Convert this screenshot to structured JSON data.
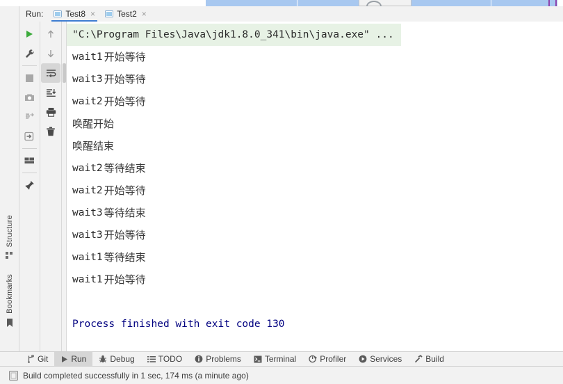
{
  "window": {
    "tool_window": "Run"
  },
  "tabbar": {
    "run_label": "Run:",
    "tabs": [
      {
        "label": "Test8",
        "close": "×",
        "active": true,
        "icon": "run-config-icon"
      },
      {
        "label": "Test2",
        "close": "×",
        "active": false,
        "icon": "run-config-icon"
      }
    ]
  },
  "toolbar_main": {
    "items": [
      {
        "name": "rerun-button",
        "icon": "play-icon",
        "tooltip": "Rerun"
      },
      {
        "name": "edit-configurations-button",
        "icon": "wrench-icon",
        "tooltip": "Modify Run Configuration"
      },
      {
        "name": "stop-button",
        "icon": "stop-square-icon",
        "tooltip": "Stop"
      },
      {
        "name": "screenshot-button",
        "icon": "camera-icon",
        "tooltip": "Screenshot"
      },
      {
        "name": "thread-dump-button",
        "icon": "thread-dump-icon",
        "tooltip": "Dump Threads"
      },
      {
        "name": "attach-button",
        "icon": "attach-arrow-icon",
        "tooltip": "Attach"
      },
      {
        "name": "layout-button",
        "icon": "layout-icon",
        "tooltip": "Layout Settings"
      },
      {
        "name": "pin-tab-button",
        "icon": "pin-icon",
        "tooltip": "Pin Tab"
      }
    ]
  },
  "toolbar_console": {
    "items": [
      {
        "name": "prev-occurrence-button",
        "icon": "arrow-up-icon",
        "tooltip": "Previous Occurrence"
      },
      {
        "name": "next-occurrence-button",
        "icon": "arrow-down-icon",
        "tooltip": "Next Occurrence"
      },
      {
        "name": "soft-wrap-button",
        "icon": "soft-wrap-icon",
        "tooltip": "Soft-Wrap",
        "active": true
      },
      {
        "name": "scroll-to-end-button",
        "icon": "scroll-to-end-icon",
        "tooltip": "Scroll to End"
      },
      {
        "name": "print-button",
        "icon": "printer-icon",
        "tooltip": "Print"
      },
      {
        "name": "clear-all-button",
        "icon": "trash-icon",
        "tooltip": "Clear All"
      }
    ]
  },
  "left_strip": {
    "items": [
      {
        "label": "Structure",
        "icon": "structure-icon"
      },
      {
        "label": "Bookmarks",
        "icon": "bookmark-icon"
      }
    ]
  },
  "console": {
    "lines": [
      {
        "type": "command",
        "text": "\"C:\\Program Files\\Java\\jdk1.8.0_341\\bin\\java.exe\" ..."
      },
      {
        "type": "log",
        "mono": "wait1",
        "cn": "开始等待"
      },
      {
        "type": "log",
        "mono": "wait3",
        "cn": "开始等待"
      },
      {
        "type": "log",
        "mono": "wait2",
        "cn": "开始等待"
      },
      {
        "type": "log",
        "mono": "",
        "cn": "唤醒开始"
      },
      {
        "type": "log",
        "mono": "",
        "cn": "唤醒结束"
      },
      {
        "type": "log",
        "mono": "wait2",
        "cn": "等待结束"
      },
      {
        "type": "log",
        "mono": "wait2",
        "cn": "开始等待"
      },
      {
        "type": "log",
        "mono": "wait3",
        "cn": "等待结束"
      },
      {
        "type": "log",
        "mono": "wait3",
        "cn": "开始等待"
      },
      {
        "type": "log",
        "mono": "wait1",
        "cn": "等待结束"
      },
      {
        "type": "log",
        "mono": "wait1",
        "cn": "开始等待"
      },
      {
        "type": "blank",
        "text": ""
      },
      {
        "type": "exit",
        "text": "Process finished with exit code 130"
      }
    ]
  },
  "bottom_bar": {
    "items": [
      {
        "label": "Git",
        "icon": "git-branch-icon",
        "active": false
      },
      {
        "label": "Run",
        "icon": "play-icon",
        "active": true
      },
      {
        "label": "Debug",
        "icon": "bug-icon",
        "active": false
      },
      {
        "label": "TODO",
        "icon": "list-icon",
        "active": false
      },
      {
        "label": "Problems",
        "icon": "info-circle-icon",
        "active": false
      },
      {
        "label": "Terminal",
        "icon": "terminal-icon",
        "active": false
      },
      {
        "label": "Profiler",
        "icon": "profiler-icon",
        "active": false
      },
      {
        "label": "Services",
        "icon": "services-icon",
        "active": false
      },
      {
        "label": "Build",
        "icon": "hammer-icon",
        "active": false
      }
    ]
  },
  "status_bar": {
    "icon": "build-status-icon",
    "message": "Build completed successfully in 1 sec, 174 ms (a minute ago)"
  },
  "colors": {
    "accent": "#3e7dd1",
    "command_bg": "#e7f2e5",
    "exit_code_text": "#000080",
    "panel_bg": "#f2f2f2",
    "console_bg": "#ffffff",
    "active_item_bg": "#d6d6d6"
  }
}
